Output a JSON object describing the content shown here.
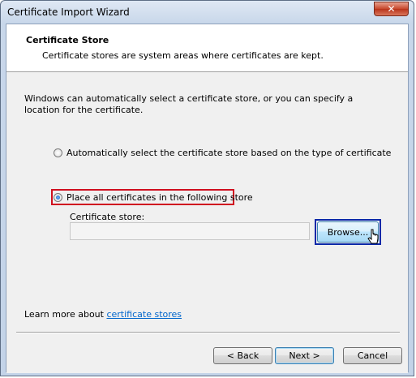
{
  "window": {
    "title": "Certificate Import Wizard",
    "close_glyph": "✕"
  },
  "header": {
    "title": "Certificate Store",
    "subtitle": "Certificate stores are system areas where certificates are kept."
  },
  "content": {
    "intro": "Windows can automatically select a certificate store, or you can specify a location for the certificate.",
    "options": [
      {
        "label": "Automatically select the certificate store based on the type of certificate",
        "checked": false
      },
      {
        "label": "Place all certificates in the following store",
        "checked": true
      }
    ],
    "store_label": "Certificate store:",
    "store_value": "",
    "browse_label": "Browse...",
    "learn_prefix": "Learn more about ",
    "learn_link": "certificate stores"
  },
  "footer": {
    "back": "< Back",
    "next": "Next >",
    "cancel": "Cancel"
  },
  "colors": {
    "highlight_red": "#d01020",
    "highlight_blue": "#0a28a8",
    "link": "#0066cc"
  }
}
